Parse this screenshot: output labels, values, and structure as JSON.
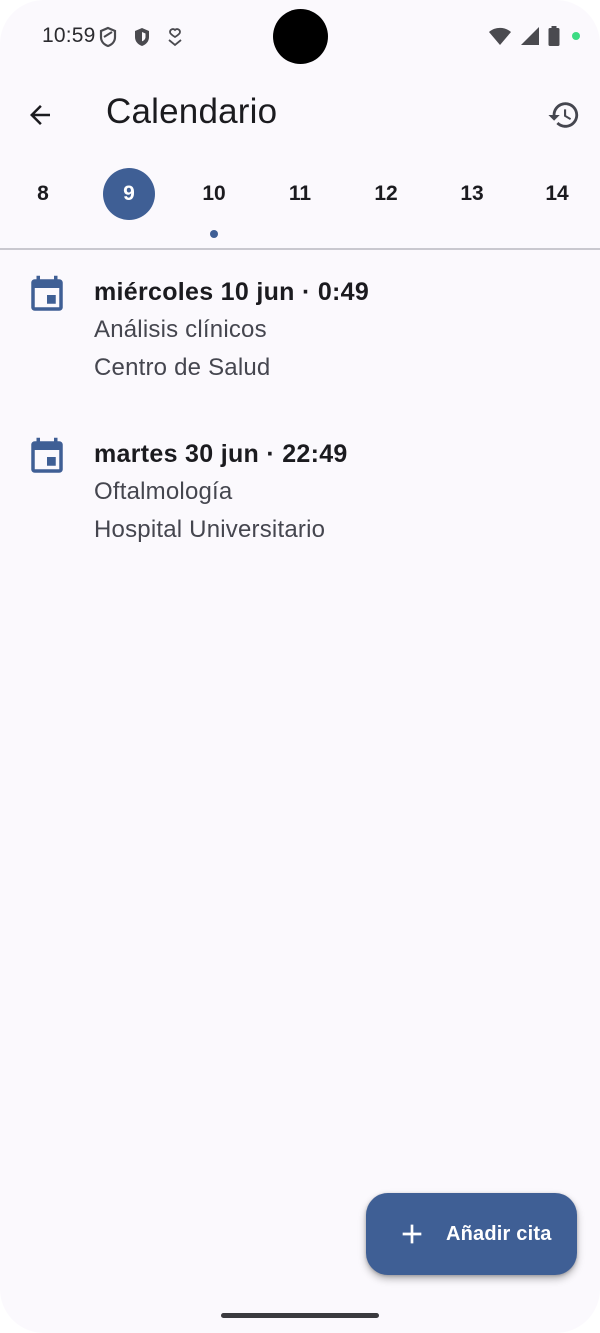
{
  "status_bar": {
    "time": "10:59",
    "left_icons": [
      "shield-outline-icon",
      "shield-filled-icon",
      "location-heart-icon"
    ],
    "right_icons": [
      "wifi-icon",
      "signal-icon",
      "battery-icon"
    ]
  },
  "app_bar": {
    "title": "Calendario",
    "back_icon": "arrow-back-icon",
    "history_icon": "history-icon"
  },
  "date_strip": {
    "days": [
      {
        "label": "8",
        "selected": false,
        "has_event": false
      },
      {
        "label": "9",
        "selected": true,
        "has_event": false
      },
      {
        "label": "10",
        "selected": false,
        "has_event": true
      },
      {
        "label": "11",
        "selected": false,
        "has_event": false
      },
      {
        "label": "12",
        "selected": false,
        "has_event": false
      },
      {
        "label": "13",
        "selected": false,
        "has_event": false
      },
      {
        "label": "14",
        "selected": false,
        "has_event": false
      }
    ]
  },
  "appointments": [
    {
      "datetime": "miércoles 10 jun · 0:49",
      "type": "Análisis clínicos",
      "place": "Centro de Salud",
      "icon": "calendar-event-icon"
    },
    {
      "datetime": "martes 30 jun · 22:49",
      "type": "Oftalmología",
      "place": "Hospital Universitario",
      "icon": "calendar-event-icon"
    }
  ],
  "fab": {
    "label": "Añadir cita",
    "icon": "plus-icon"
  },
  "colors": {
    "primary": "#3f5f95",
    "background": "#fbf9fd",
    "text": "#1b1b1f",
    "secondary_text": "#45464f",
    "divider": "#c9c8cf"
  }
}
